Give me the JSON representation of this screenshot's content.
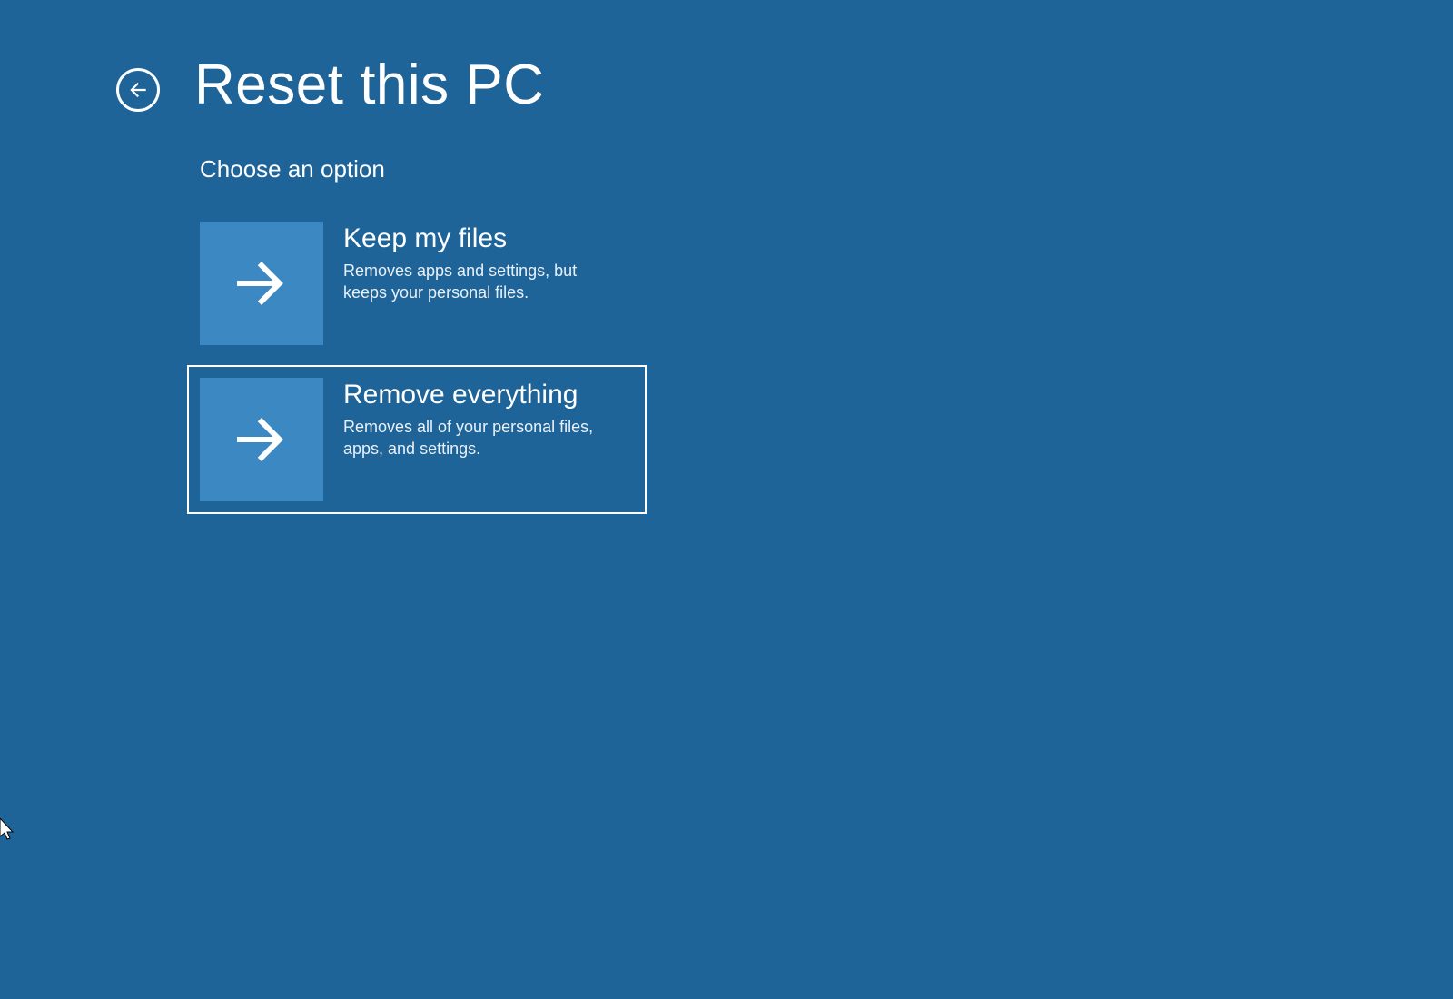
{
  "header": {
    "title": "Reset this PC"
  },
  "subtitle": "Choose an option",
  "options": [
    {
      "title": "Keep my files",
      "description": "Removes apps and settings, but keeps your personal files."
    },
    {
      "title": "Remove everything",
      "description": "Removes all of your personal files, apps, and settings."
    }
  ]
}
